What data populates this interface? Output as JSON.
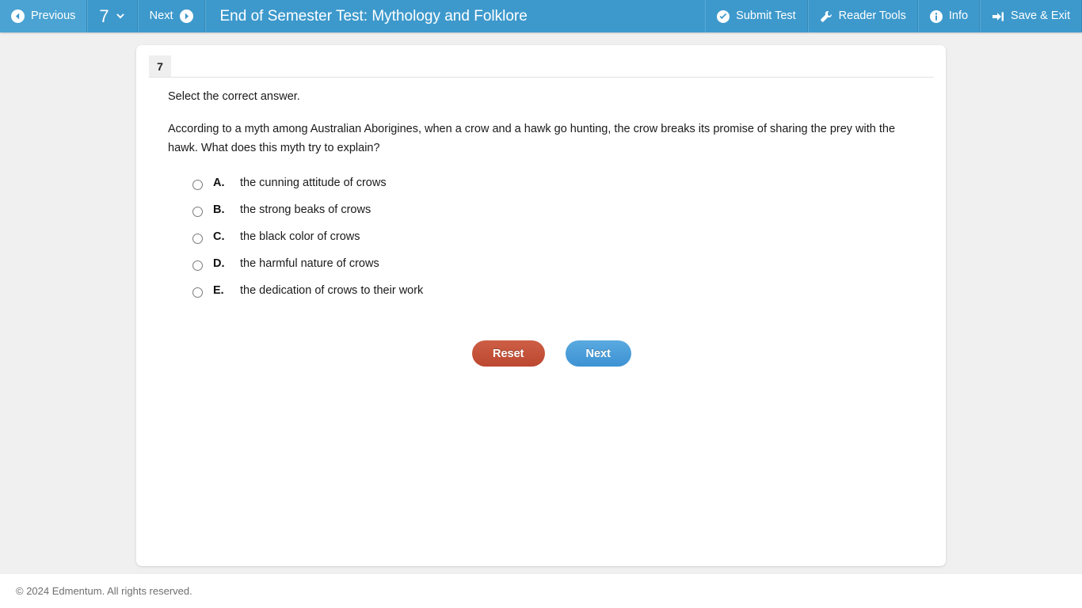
{
  "toolbar": {
    "previous_label": "Previous",
    "previous_icon": "arrow-circle-left-icon",
    "question_number": "7",
    "question_dropdown_icon": "chevron-down-icon",
    "next_label": "Next",
    "next_icon": "arrow-circle-right-icon",
    "title": "End of Semester Test: Mythology and Folklore",
    "submit_label": "Submit Test",
    "submit_icon": "check-circle-icon",
    "reader_tools_label": "Reader Tools",
    "reader_tools_icon": "wrench-icon",
    "info_label": "Info",
    "info_icon": "info-circle-icon",
    "save_exit_label": "Save & Exit",
    "save_exit_icon": "sign-out-icon",
    "background_color": "#3d99cc"
  },
  "question": {
    "number": "7",
    "instruction": "Select the correct answer.",
    "text": "According to a myth among Australian Aborigines, when a crow and a hawk go hunting, the crow breaks its promise of sharing the prey with the hawk. What does this myth try to explain?",
    "options": [
      {
        "letter": "A.",
        "text": "the cunning attitude of crows",
        "selected": false
      },
      {
        "letter": "B.",
        "text": "the strong beaks of crows",
        "selected": false
      },
      {
        "letter": "C.",
        "text": "the black color of crows",
        "selected": false
      },
      {
        "letter": "D.",
        "text": "the harmful nature of crows",
        "selected": false
      },
      {
        "letter": "E.",
        "text": "the dedication of crows to their work",
        "selected": false
      }
    ]
  },
  "actions": {
    "reset_label": "Reset",
    "reset_color": "#c14e36",
    "next_label": "Next",
    "next_color": "#4a9ed9"
  },
  "footer": {
    "copyright": "© 2024 Edmentum. All rights reserved."
  }
}
